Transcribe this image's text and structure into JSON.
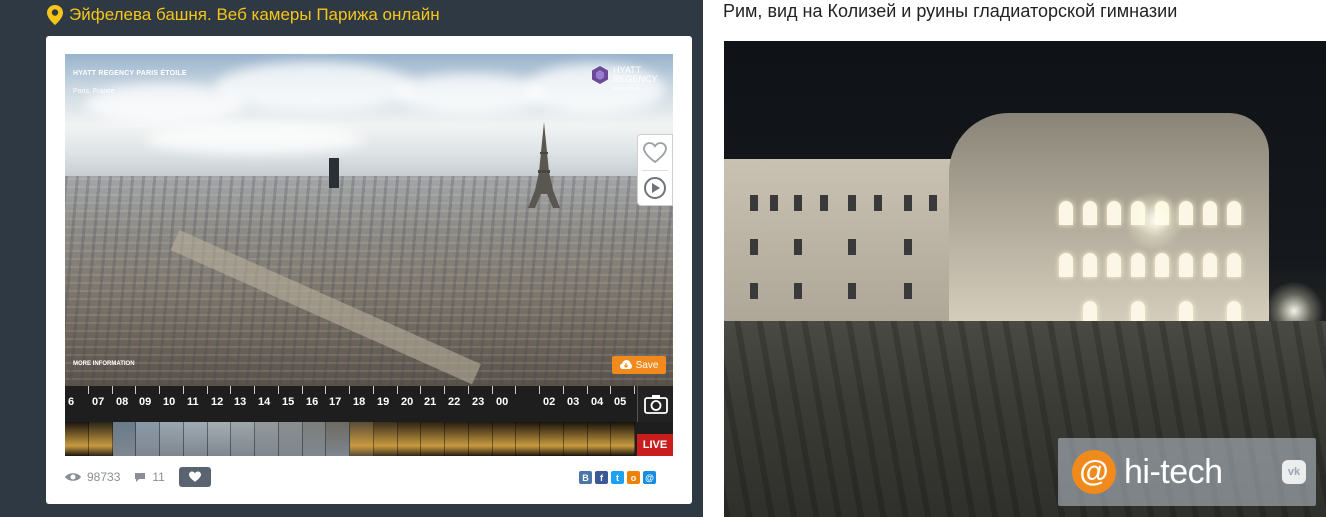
{
  "left": {
    "title": "Эйфелева башня. Веб камеры Парижа онлайн",
    "title_color": "#f5c518",
    "icon": "map-pin-icon",
    "player": {
      "hotel_overlay": "HYATT REGENCY PARIS ÉTOILE",
      "city_overlay": "Paris, France",
      "brand_logo_line1": "HYATT",
      "brand_logo_line2": "REGENCY",
      "brand_logo_sub": "PARIS ÉTOILE",
      "more_info": "MORE INFORMATION",
      "save_label": "Save",
      "save_color": "#f08a1c",
      "live_label": "LIVE",
      "live_color": "#c81e1e",
      "hours": [
        "6",
        "07",
        "08",
        "09",
        "10",
        "11",
        "12",
        "13",
        "14",
        "15",
        "16",
        "17",
        "18",
        "19",
        "20",
        "21",
        "22",
        "23",
        "00",
        "",
        "02",
        "03",
        "04",
        "05"
      ],
      "favorite_icon": "heart-icon",
      "play_icon": "play-circle-icon",
      "camera_icon": "camera-icon"
    },
    "stats": {
      "views": "98733",
      "comments": "11",
      "views_icon": "eye-icon",
      "comments_icon": "comment-icon",
      "like_icon": "heart-icon"
    },
    "share": [
      {
        "label": "В",
        "color": "#4a76a8",
        "icon": "vk-icon"
      },
      {
        "label": "f",
        "color": "#3b5998",
        "icon": "facebook-icon"
      },
      {
        "label": "t",
        "color": "#1da1f2",
        "icon": "twitter-icon"
      },
      {
        "label": "о",
        "color": "#ee8208",
        "icon": "odnoklassniki-icon"
      },
      {
        "label": "@",
        "color": "#168de2",
        "icon": "mailru-icon"
      }
    ]
  },
  "right": {
    "title": "Рим, вид на Колизей и руины гладиаторской гимназии",
    "watermark_text": "hi-tech",
    "watermark_at": "@",
    "watermark_vk": "vk"
  }
}
